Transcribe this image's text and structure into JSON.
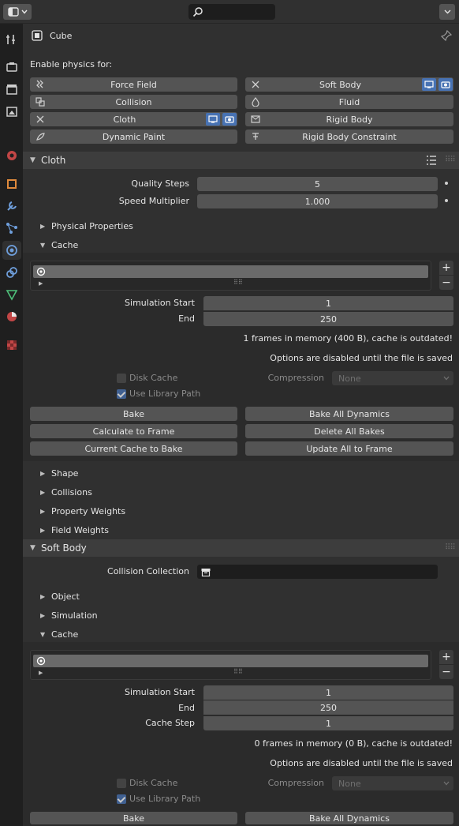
{
  "header": {
    "object_name": "Cube",
    "editor_icon": "properties-editor-icon",
    "search_placeholder": ""
  },
  "tabs": [
    "tool-icon",
    "render-icon",
    "output-icon",
    "view-layer-icon",
    "scene-icon",
    "object-icon",
    "modifier-icon",
    "particles-icon",
    "physics-icon",
    "constraints-icon",
    "data-icon",
    "material-icon",
    "texture-icon"
  ],
  "enable_physics": {
    "label": "Enable physics for:",
    "force_field": "Force Field",
    "soft_body": "Soft Body",
    "collision": "Collision",
    "fluid": "Fluid",
    "cloth": "Cloth",
    "rigid_body": "Rigid Body",
    "dynamic_paint": "Dynamic Paint",
    "rigid_body_constraint": "Rigid Body Constraint"
  },
  "cloth": {
    "title": "Cloth",
    "quality_steps_label": "Quality Steps",
    "quality_steps": "5",
    "speed_multiplier_label": "Speed Multiplier",
    "speed_multiplier": "1.000",
    "physical_properties": "Physical Properties",
    "cache": {
      "title": "Cache",
      "sim_start_label": "Simulation Start",
      "sim_start": "1",
      "end_label": "End",
      "end": "250",
      "info1": "1 frames in memory (400 B), cache is outdated!",
      "info2": "Options are disabled until the file is saved",
      "disk_cache": "Disk Cache",
      "use_library_path": "Use Library Path",
      "compression_label": "Compression",
      "compression": "None",
      "bake": "Bake",
      "bake_all": "Bake All Dynamics",
      "calc_frame": "Calculate to Frame",
      "delete_all": "Delete All Bakes",
      "current_cache": "Current Cache to Bake",
      "update_all": "Update All to Frame"
    },
    "shape": "Shape",
    "collisions": "Collisions",
    "property_weights": "Property Weights",
    "field_weights": "Field Weights"
  },
  "soft_body": {
    "title": "Soft Body",
    "collision_collection_label": "Collision Collection",
    "object": "Object",
    "simulation": "Simulation",
    "cache": {
      "title": "Cache",
      "sim_start_label": "Simulation Start",
      "sim_start": "1",
      "end_label": "End",
      "end": "250",
      "cache_step_label": "Cache Step",
      "cache_step": "1",
      "info1": "0 frames in memory (0 B), cache is outdated!",
      "info2": "Options are disabled until the file is saved",
      "disk_cache": "Disk Cache",
      "use_library_path": "Use Library Path",
      "compression_label": "Compression",
      "compression": "None",
      "bake": "Bake",
      "bake_all": "Bake All Dynamics"
    }
  },
  "colors": {
    "accent": "#4772b3",
    "button": "#545454",
    "panel": "#3d3d3d",
    "background": "#303030"
  }
}
